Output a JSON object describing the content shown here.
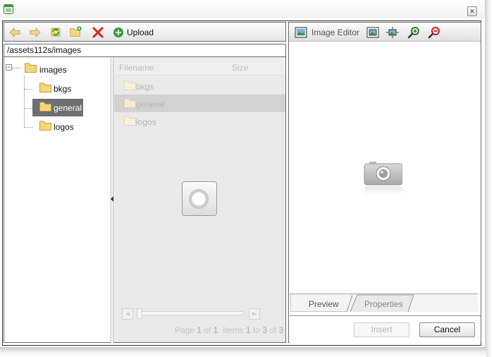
{
  "window": {
    "close_glyph": "✕"
  },
  "left_toolbar": {
    "upload_label": "Upload",
    "buttons": [
      "back-icon",
      "forward-icon",
      "refresh-icon",
      "new-folder-icon",
      "delete-icon",
      "upload-icon"
    ]
  },
  "path": "/assets112s/images",
  "tree": {
    "root": {
      "label": "images",
      "expanded": true,
      "expander": "−"
    },
    "children": [
      {
        "label": "bkgs",
        "selected": false
      },
      {
        "label": "general",
        "selected": true
      },
      {
        "label": "logos",
        "selected": false
      }
    ]
  },
  "file_list": {
    "headers": {
      "filename": "Filename",
      "size": "Size"
    },
    "rows": [
      {
        "name": "bkgs",
        "selected": false
      },
      {
        "name": "general",
        "selected": true
      },
      {
        "name": "logos",
        "selected": false
      }
    ],
    "pager": {
      "page_word": "Page",
      "page": "1",
      "of_word": "of",
      "total_pages": "1",
      "items_word": ". Items",
      "from": "1",
      "to_word": "to",
      "to": "3",
      "of_word2": "of",
      "total_items": "3"
    }
  },
  "image_editor": {
    "label": "Image Editor",
    "toolbar_icons": [
      "image-editor-icon",
      "fit-icon",
      "actual-size-icon",
      "zoom-in-icon",
      "zoom-out-icon"
    ]
  },
  "tabs": [
    {
      "label": "Preview",
      "active": true
    },
    {
      "label": "Properties",
      "active": false
    }
  ],
  "buttons": {
    "insert": "Insert",
    "cancel": "Cancel"
  },
  "colors": {
    "folder": "#f5d77b",
    "selection": "#6f6f6f",
    "delete": "#d92020",
    "add": "#2e9e3a"
  }
}
